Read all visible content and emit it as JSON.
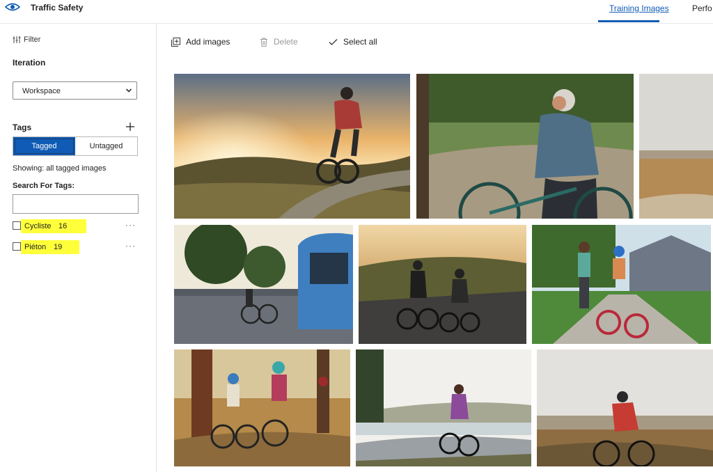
{
  "header": {
    "title": "Traffic Safety",
    "tabs": [
      {
        "label": "Training Images",
        "active": true
      },
      {
        "label": "Perfo",
        "active": false
      }
    ],
    "accent": "#0f5bb5"
  },
  "sidebar": {
    "filter_label": "Filter",
    "iteration_heading": "Iteration",
    "iteration_selected": "Workspace",
    "tags_heading": "Tags",
    "toggle": {
      "tagged": "Tagged",
      "untagged": "Untagged",
      "selected": "tagged"
    },
    "showing": "Showing: all tagged images",
    "search_heading": "Search For Tags:",
    "search_value": "",
    "tags": [
      {
        "name": "Cycliste",
        "count": "16",
        "checked": false
      },
      {
        "name": "Piéton",
        "count": "19",
        "checked": false
      }
    ],
    "highlight_color": "#ffff3a"
  },
  "toolbar": {
    "add_label": "Add images",
    "delete_label": "Delete",
    "select_all_label": "Select all"
  },
  "gallery": {
    "images": [
      {
        "scene": "cyclist-sunset-hill"
      },
      {
        "scene": "woman-teal-bike-path"
      },
      {
        "scene": "dry-field-edge"
      },
      {
        "scene": "cyclists-beside-blue-tram"
      },
      {
        "scene": "two-road-cyclists-dusk"
      },
      {
        "scene": "child-bike-with-father-sidewalk"
      },
      {
        "scene": "family-forest-ride"
      },
      {
        "scene": "woman-riverside-path"
      },
      {
        "scene": "cyclist-red-jersey-field"
      }
    ]
  }
}
